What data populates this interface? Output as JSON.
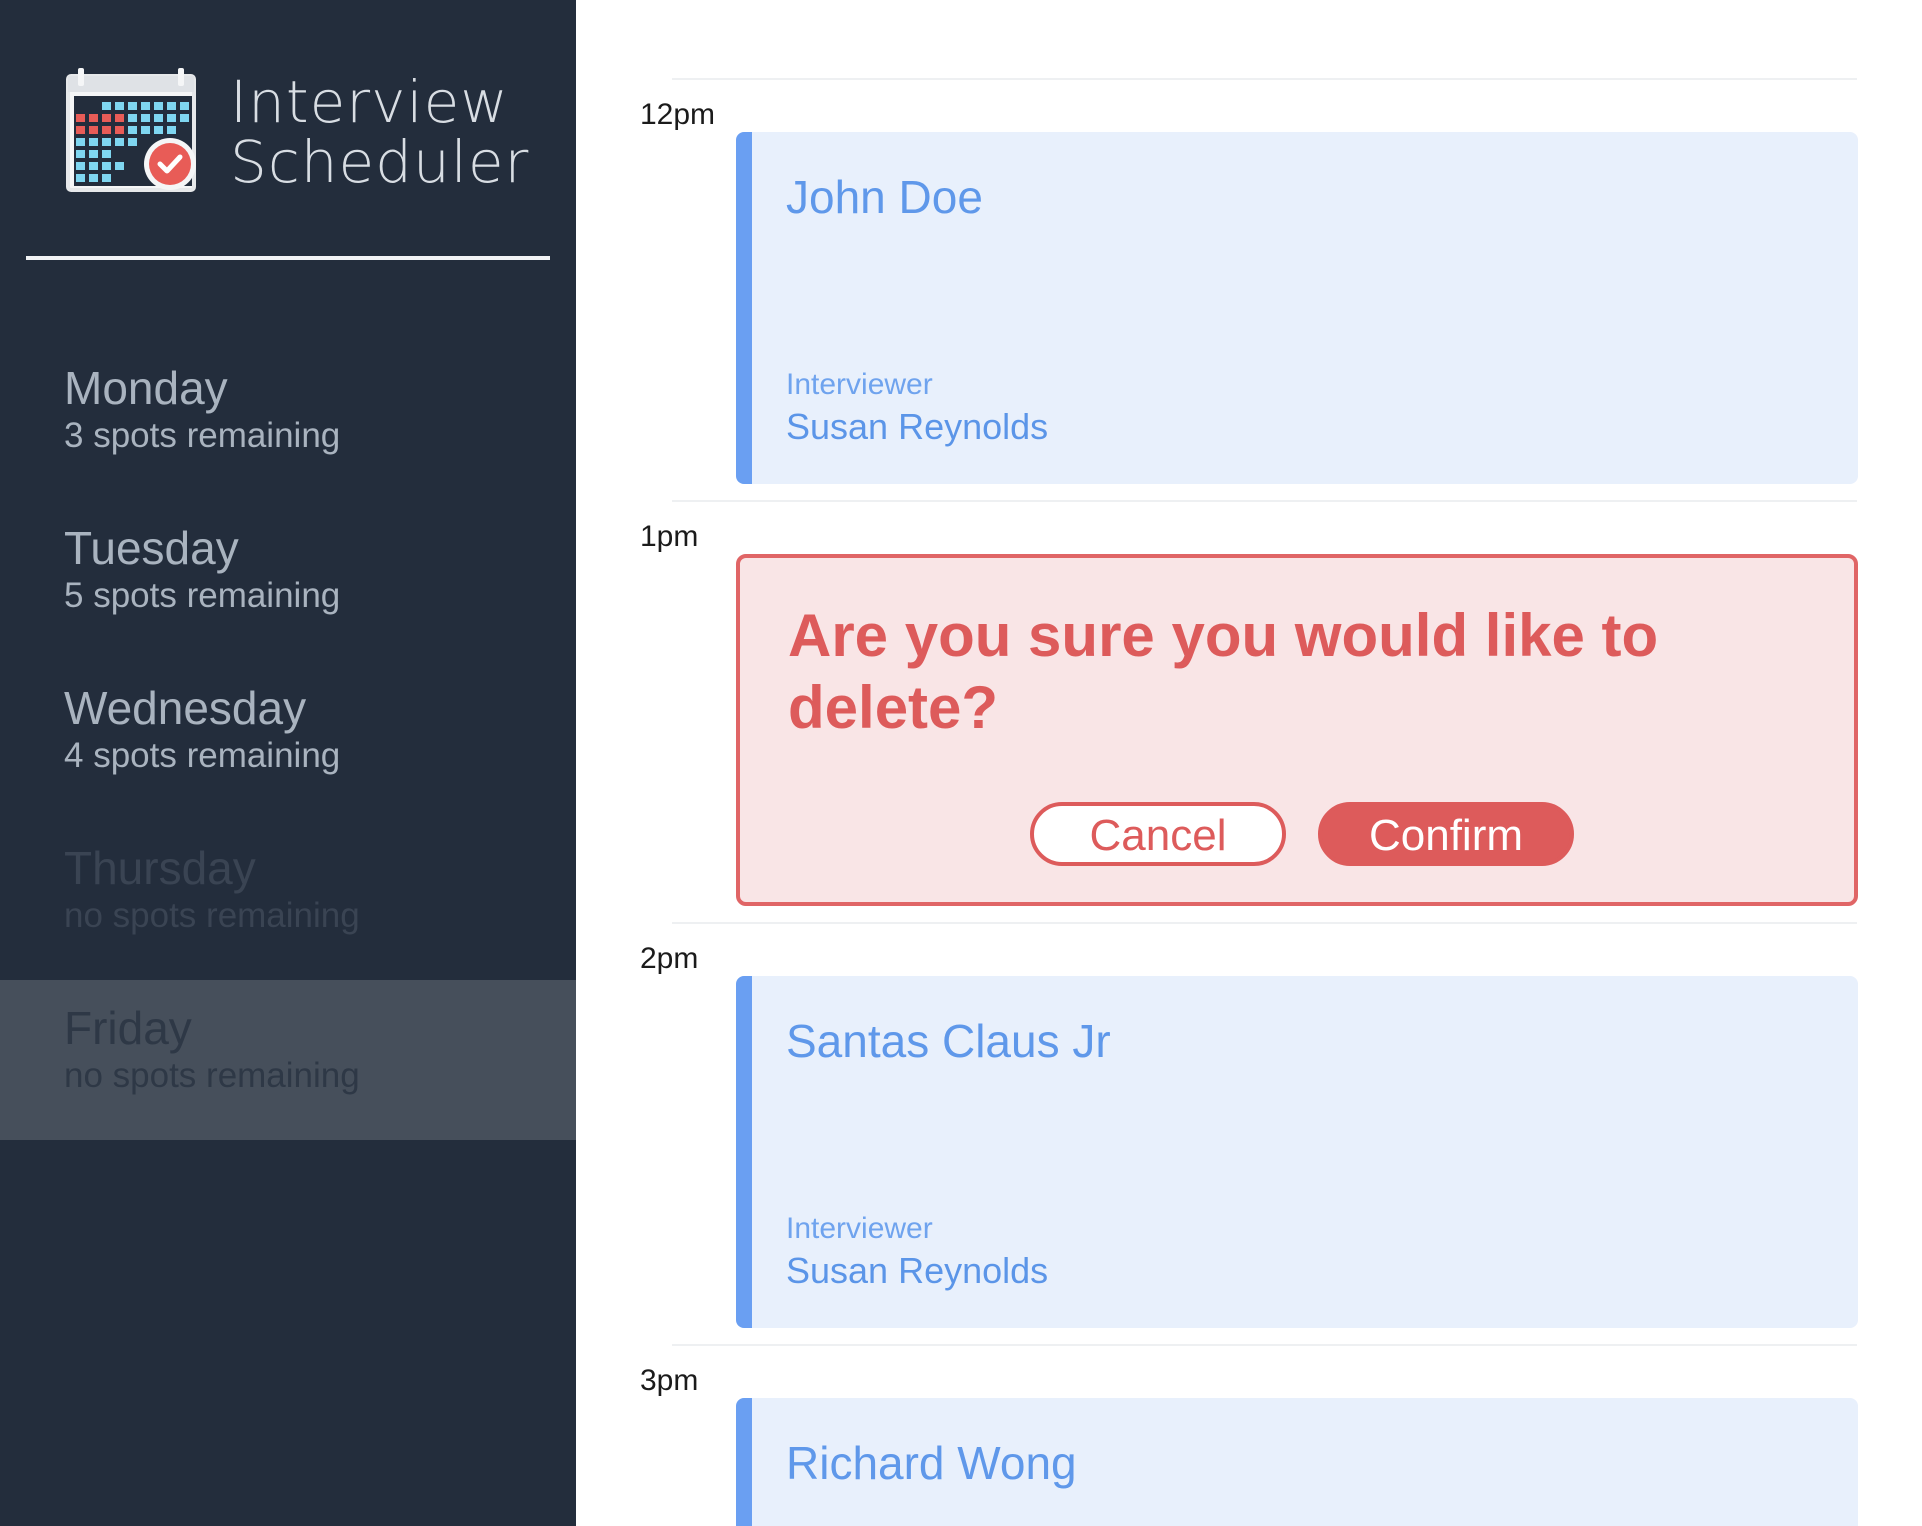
{
  "app": {
    "title_line1": "Interview",
    "title_line2": "Scheduler",
    "logo_icon": "calendar-check-icon"
  },
  "days": [
    {
      "name": "Monday",
      "spots": "3 spots remaining",
      "full": false,
      "selected": false
    },
    {
      "name": "Tuesday",
      "spots": "5 spots remaining",
      "full": false,
      "selected": false
    },
    {
      "name": "Wednesday",
      "spots": "4 spots remaining",
      "full": false,
      "selected": false
    },
    {
      "name": "Thursday",
      "spots": "no spots remaining",
      "full": true,
      "selected": false
    },
    {
      "name": "Friday",
      "spots": "no spots remaining",
      "full": true,
      "selected": true
    }
  ],
  "schedule": {
    "slots": [
      {
        "time": "12pm",
        "student": "John Doe",
        "interviewer_caption": "Interviewer",
        "interviewer": "Susan Reynolds"
      },
      {
        "time": "1pm",
        "confirm_message": "Are you sure you would like to delete?",
        "cancel_label": "Cancel",
        "confirm_label": "Confirm"
      },
      {
        "time": "2pm",
        "student": "Santas Claus Jr",
        "interviewer_caption": "Interviewer",
        "interviewer": "Susan Reynolds"
      },
      {
        "time": "3pm",
        "student": "Richard Wong"
      }
    ]
  },
  "colors": {
    "sidebar_bg": "#232d3c",
    "selected_day_bg": "#464f5b",
    "appointment_bg": "#e8f0fc",
    "appointment_accent": "#6a9ff2",
    "danger": "#dd5b5b",
    "danger_bg": "#f9e5e6"
  }
}
